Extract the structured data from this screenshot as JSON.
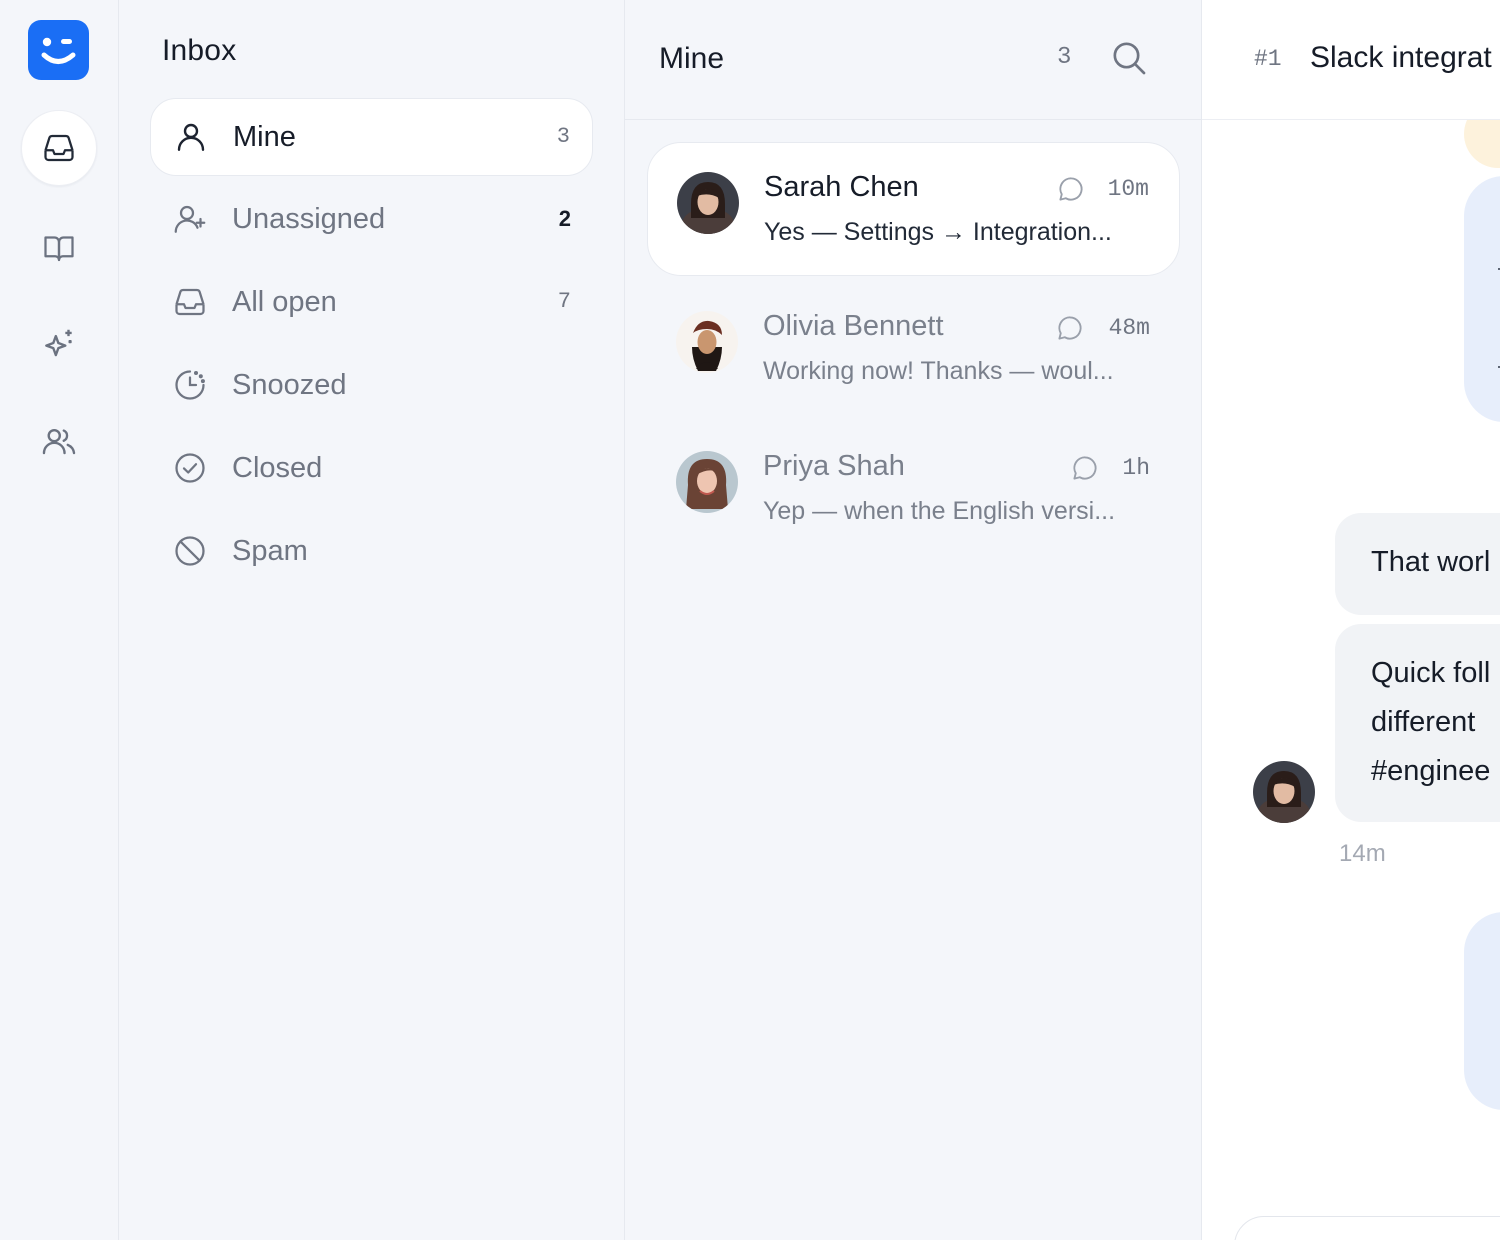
{
  "rail": {
    "logo": "wink-face-logo",
    "items": [
      {
        "icon": "inbox-icon",
        "active": true
      },
      {
        "icon": "book-open-icon",
        "active": false
      },
      {
        "icon": "sparkles-icon",
        "active": false
      },
      {
        "icon": "users-icon",
        "active": false
      }
    ]
  },
  "folders": {
    "title": "Inbox",
    "items": [
      {
        "label": "Mine",
        "count": "3",
        "icon": "user-icon"
      },
      {
        "label": "Unassigned",
        "count": "2",
        "icon": "user-plus-icon"
      },
      {
        "label": "All open",
        "count": "7",
        "icon": "inbox-icon"
      },
      {
        "label": "Snoozed",
        "count": "",
        "icon": "snooze-clock-icon"
      },
      {
        "label": "Closed",
        "count": "",
        "icon": "check-circle-icon"
      },
      {
        "label": "Spam",
        "count": "",
        "icon": "ban-icon"
      }
    ]
  },
  "list": {
    "title": "Mine",
    "count": "3",
    "conversations": [
      {
        "name": "Sarah Chen",
        "time": "10m",
        "preview": "Yes — Settings → Integration..."
      },
      {
        "name": "Olivia Bennett",
        "time": "48m",
        "preview": "Working now! Thanks — woul..."
      },
      {
        "name": "Priya Shah",
        "time": "1h",
        "preview": "Yep — when the English versi..."
      }
    ]
  },
  "detail": {
    "ticket_number": "#1",
    "title": "Slack integrat",
    "messages": [
      {
        "lines": [
          "That worl"
        ]
      },
      {
        "lines": [
          "Quick foll",
          "different",
          "#enginee"
        ]
      }
    ],
    "message_time": "14m"
  },
  "colors": {
    "accent": "#1a6ef5",
    "background": "#f4f6fa",
    "panel": "#ffffff",
    "muted_text": "#6f7582",
    "agent_bubble": "#e7eefb",
    "customer_bubble": "#f1f3f6"
  }
}
